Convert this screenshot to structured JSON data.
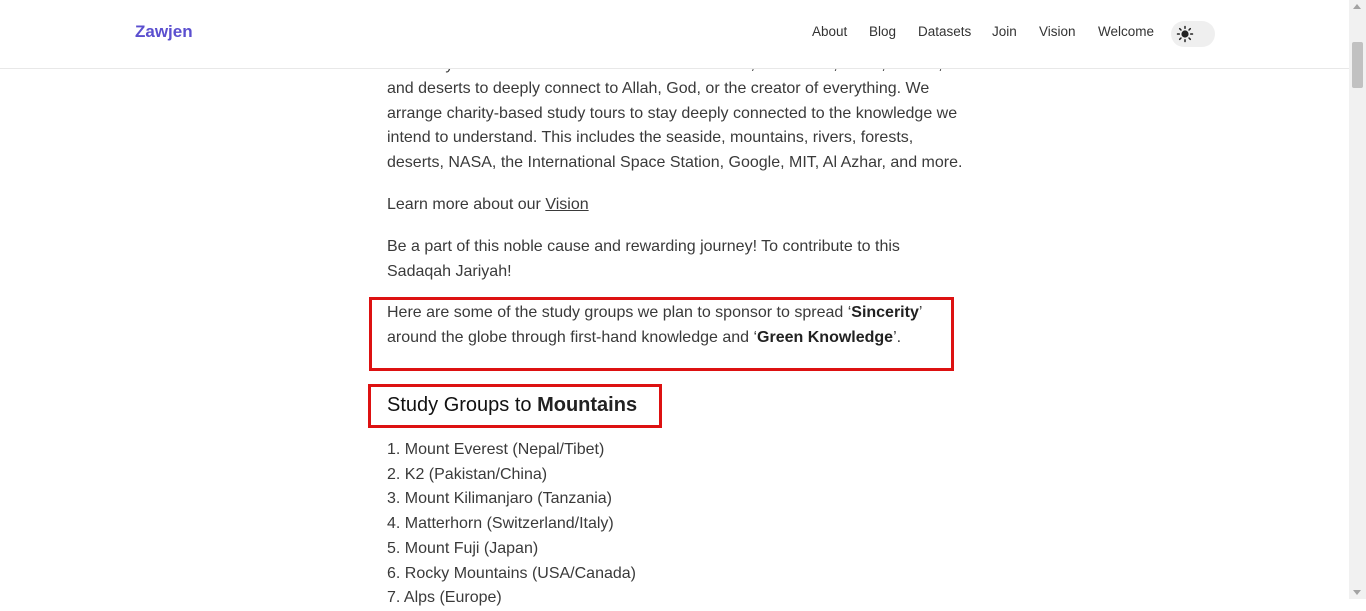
{
  "header": {
    "brand": "Zawjen",
    "nav": [
      "About",
      "Blog",
      "Datasets",
      "Join",
      "Vision",
      "Welcome"
    ],
    "theme_toggle_icon": "sun-icon"
  },
  "content": {
    "partial_line": "We study around the love of nature like the seaside, mountains, rivers, forests,",
    "intro_rest": "and deserts to deeply connect to Allah, God, or the creator of everything. We arrange charity-based study tours to stay deeply connected to the knowledge we intend to understand. This includes the seaside, mountains, rivers, forests, deserts, NASA, the International Space Station, Google, MIT, Al Azhar, and more.",
    "learn_more_prefix": "Learn more about our ",
    "learn_more_link": "Vision",
    "contribute": "Be a part of this noble cause and rewarding journey! To contribute to this Sadaqah Jariyah!",
    "groups_intro": {
      "t1": "Here are some of the study groups we plan to sponsor to spread ‘",
      "b1": "Sincerity",
      "t2": "’ around the globe through first-hand knowledge and ‘",
      "b2": "Green Knowledge",
      "t3": "’."
    },
    "section_heading_prefix": "Study Groups to ",
    "section_heading_bold": "Mountains",
    "mountains": [
      "1. Mount Everest (Nepal/Tibet)",
      "2. K2 (Pakistan/China)",
      "3. Mount Kilimanjaro (Tanzania)",
      "4. Matterhorn (Switzerland/Italy)",
      "5. Mount Fuji (Japan)",
      "6. Rocky Mountains (USA/Canada)",
      "7. Alps (Europe)"
    ]
  },
  "colors": {
    "brand": "#5b4fcf",
    "highlight_border": "#dd1111"
  }
}
